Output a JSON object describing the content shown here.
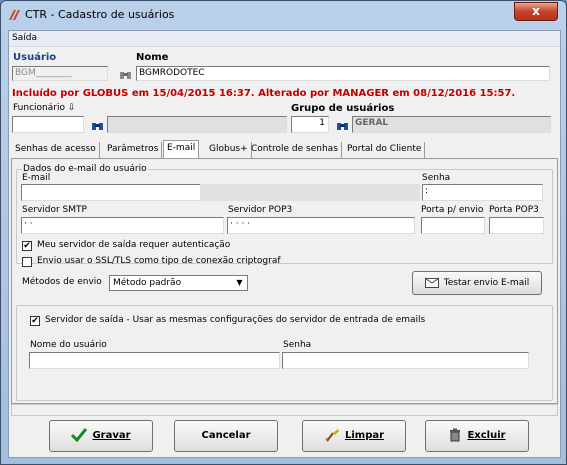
{
  "window": {
    "title": "CTR - Cadastro de usuários",
    "close_label": "x"
  },
  "menu": {
    "saida": "Saída"
  },
  "header": {
    "usuario_label": "Usuário",
    "usuario_value": "BGM________",
    "nome_label": "Nome",
    "nome_value": "BGMRODOTEC",
    "audit_text": "Incluído por GLOBUS em 15/04/2015 16:37. Alterado por MANAGER em 08/12/2016 15:57.",
    "funcionario_label": "Funcionário",
    "funcionario_value": "",
    "grupo_label": "Grupo de usuários",
    "grupo_code": "1",
    "grupo_name": "GERAL"
  },
  "tabs": [
    {
      "label": "Senhas de acesso"
    },
    {
      "label": "Parâmetros"
    },
    {
      "label": "E-mail"
    },
    {
      "label": "Globus+"
    },
    {
      "label": "Controle de senhas"
    },
    {
      "label": "Portal do Cliente"
    }
  ],
  "email_tab": {
    "group_title": "Dados do e-mail do usuário",
    "email_label": "E-mail",
    "email_value": "",
    "senha_label": "Senha",
    "senha_value": ":",
    "smtp_label": "Servidor SMTP",
    "smtp_value": "· ·",
    "pop3_label": "Servidor POP3",
    "pop3_value": "· · · ·",
    "porta_envio_label": "Porta p/ envio",
    "porta_envio_value": "",
    "porta_pop3_label": "Porta POP3",
    "porta_pop3_value": "",
    "auth_checkbox_label": "Meu servidor de saída requer autenticação",
    "auth_checked": true,
    "ssl_checkbox_label": "Envio usar o SSL/TLS como tipo de conexão criptograf",
    "ssl_checked": false,
    "metodo_label": "Métodos de envio",
    "metodo_value": "Método padrão",
    "test_button": "Testar envio E-mail",
    "same_config_label": "Servidor de saída - Usar as mesmas configurações do servidor de entrada de emails",
    "same_config_checked": true,
    "nome_usuario_label": "Nome do usuário",
    "nome_usuario_value": "",
    "senha2_label": "Senha",
    "senha2_value": ""
  },
  "buttons": {
    "gravar": "Gravar",
    "cancelar": "Cancelar",
    "limpar": "Limpar",
    "excluir": "Excluir"
  }
}
